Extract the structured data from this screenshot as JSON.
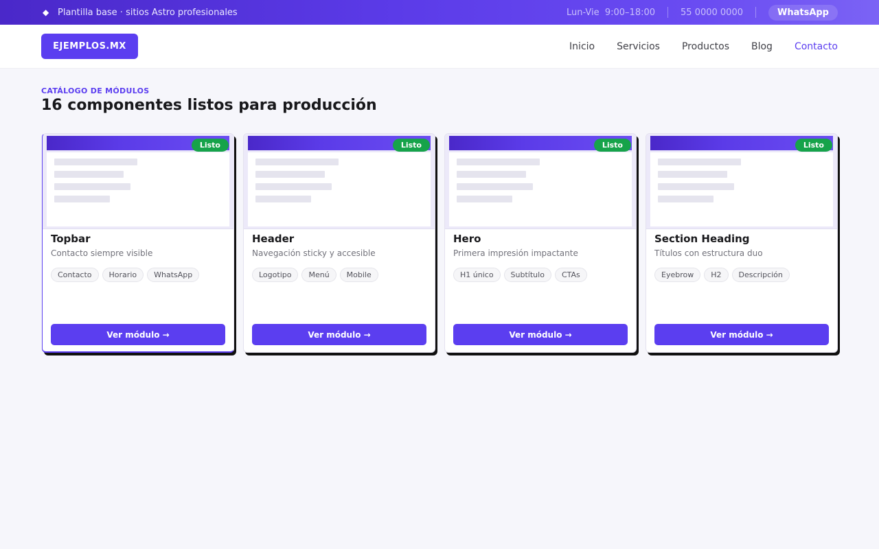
{
  "topbar": {
    "tagline": "Plantilla base · sitios Astro profesionales",
    "hours": "Lun-Vie  9:00–18:00",
    "phone": "55 0000 0000",
    "whatsapp_label": "WhatsApp"
  },
  "header": {
    "logo": "EJEMPLOS.MX",
    "nav": [
      {
        "label": "Inicio"
      },
      {
        "label": "Servicios"
      },
      {
        "label": "Productos"
      },
      {
        "label": "Blog"
      },
      {
        "label": "Contacto",
        "active": true
      }
    ]
  },
  "catalog": {
    "eyebrow": "CATÁLOGO DE MÓDULOS",
    "title": "16 componentes listos para producción",
    "cards": [
      {
        "badge": "Listo",
        "title": "Topbar",
        "desc": "Contacto siempre visible",
        "tags": [
          "Contacto",
          "Horario",
          "WhatsApp"
        ],
        "button": "Ver módulo →"
      },
      {
        "badge": "Listo",
        "title": "Header",
        "desc": "Navegación sticky y accesible",
        "tags": [
          "Logotipo",
          "Menú",
          "Mobile"
        ],
        "button": "Ver módulo →"
      },
      {
        "badge": "Listo",
        "title": "Hero",
        "desc": "Primera impresión impactante",
        "tags": [
          "H1 único",
          "Subtítulo",
          "CTAs"
        ],
        "button": "Ver módulo →"
      },
      {
        "badge": "Listo",
        "title": "Section Heading",
        "desc": "Títulos con estructura duo",
        "tags": [
          "Eyebrow",
          "H2",
          "Descripción"
        ],
        "button": "Ver módulo →"
      }
    ]
  },
  "colors": {
    "brand": "#5b3ef0",
    "topbar_gradient_start": "#4a28c9",
    "badge_green": "#16a34a",
    "background": "#f6f6fb"
  },
  "icons": {
    "topbar_bullet": "diamond-icon"
  }
}
